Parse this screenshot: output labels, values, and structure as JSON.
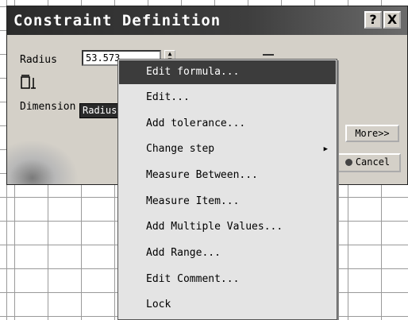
{
  "dialog": {
    "title": "Constraint Definition",
    "help_label": "?",
    "close_label": "X",
    "radius_label": "Radius",
    "radius_value": "53.573",
    "dimension_label": "Dimension",
    "dimension_value": "Radius",
    "more_label": "More>>",
    "cancel_label": "Cancel"
  },
  "context_menu": {
    "items": [
      {
        "label": "Edit formula...",
        "highlighted": true,
        "submenu": false
      },
      {
        "label": "Edit...",
        "highlighted": false,
        "submenu": false
      },
      {
        "label": "Add tolerance...",
        "highlighted": false,
        "submenu": false
      },
      {
        "label": "Change step",
        "highlighted": false,
        "submenu": true
      },
      {
        "label": "Measure Between...",
        "highlighted": false,
        "submenu": false
      },
      {
        "label": "Measure Item...",
        "highlighted": false,
        "submenu": false
      },
      {
        "label": "Add Multiple Values...",
        "highlighted": false,
        "submenu": false
      },
      {
        "label": "Add Range...",
        "highlighted": false,
        "submenu": false
      },
      {
        "label": "Edit Comment...",
        "highlighted": false,
        "submenu": false
      },
      {
        "label": "Lock",
        "highlighted": false,
        "submenu": false
      }
    ]
  },
  "colors": {
    "titlebar": "#2b2b2b",
    "highlight": "#3c3c3c",
    "dialog_bg": "#d4d0c8"
  },
  "icons": [
    "help-icon",
    "close-icon",
    "spin-arrow-icon",
    "radius-dimension-icon",
    "submenu-arrow-icon",
    "cancel-icon"
  ]
}
